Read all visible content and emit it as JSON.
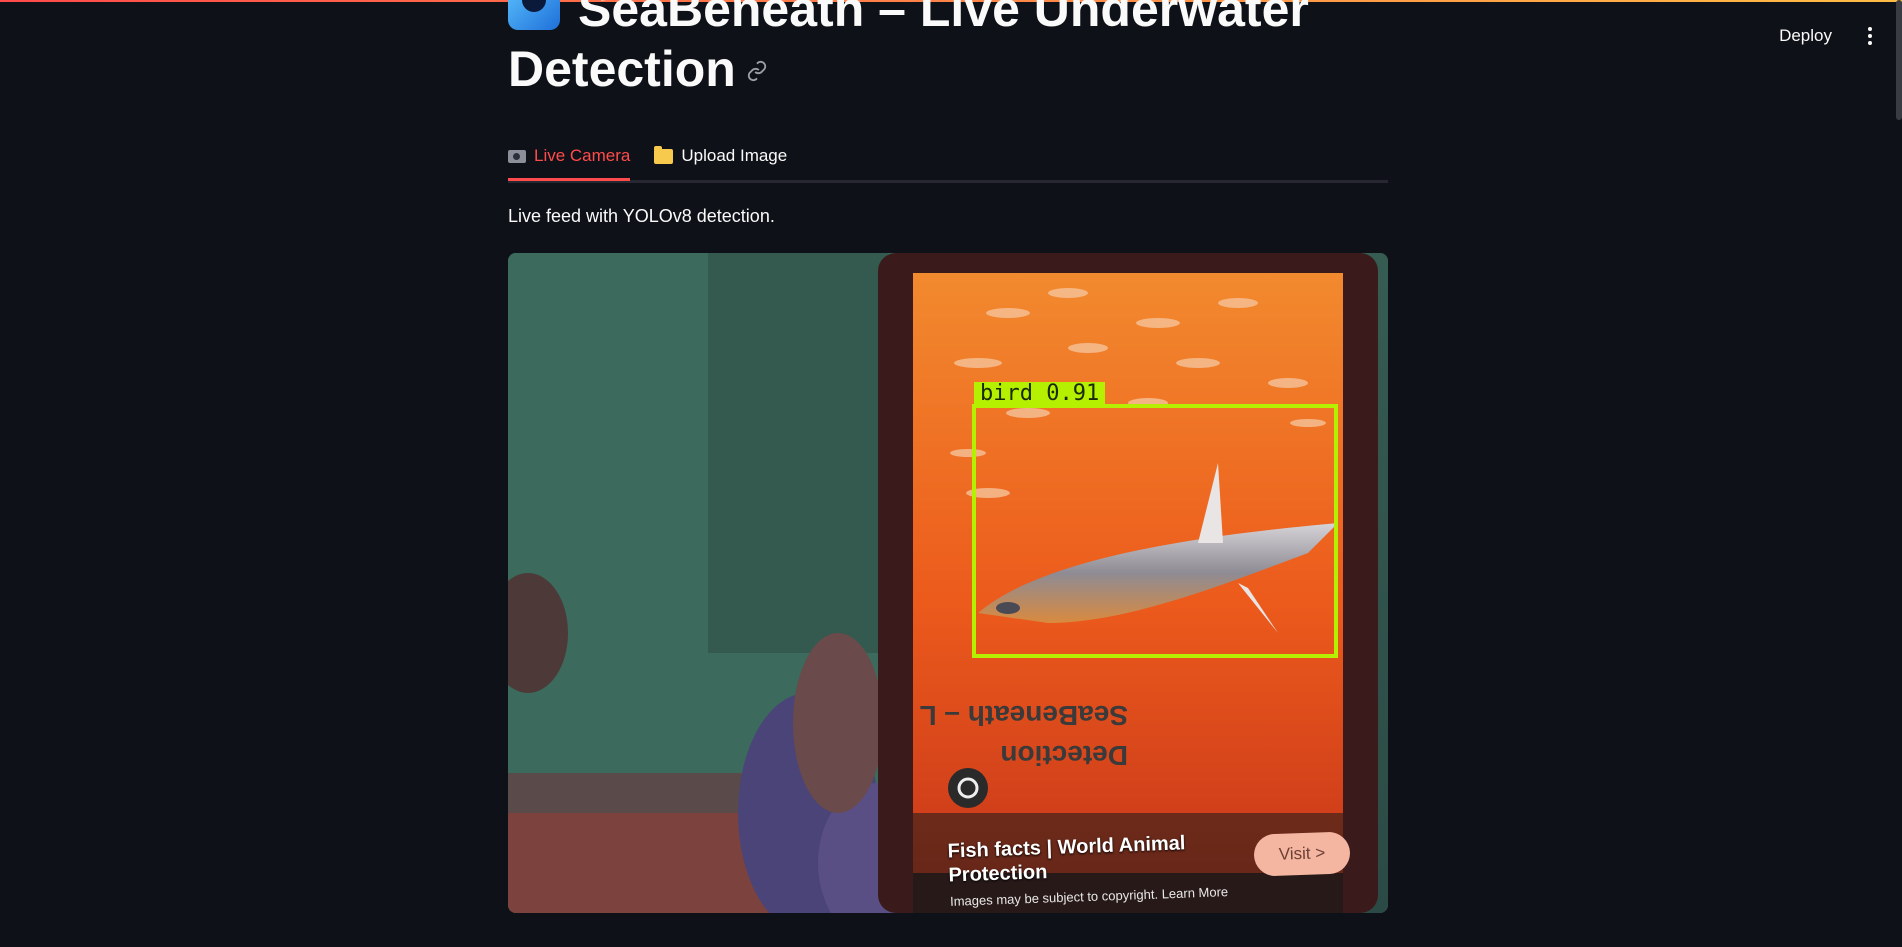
{
  "header": {
    "deploy_label": "Deploy",
    "menu_icon": "more-vertical-icon"
  },
  "page": {
    "title": "SeaBeneath – Live Underwater Detection",
    "title_icon": "water-wave-icon",
    "link_icon": "link-icon"
  },
  "tabs": [
    {
      "label": "Live Camera",
      "icon": "camera-icon",
      "active": true
    },
    {
      "label": "Upload Image",
      "icon": "folder-icon",
      "active": false
    }
  ],
  "caption": "Live feed with YOLOv8 detection.",
  "feed": {
    "detection": {
      "label": "bird 0.91",
      "color": "#b4f000"
    },
    "phone_caption": "Fish facts | World Animal Protection",
    "phone_note": "Images may be subject to copyright. Learn More",
    "visit_label": "Visit >"
  },
  "colors": {
    "background": "#0e1117",
    "accent": "#ff4b4b",
    "text": "#fafafa"
  }
}
